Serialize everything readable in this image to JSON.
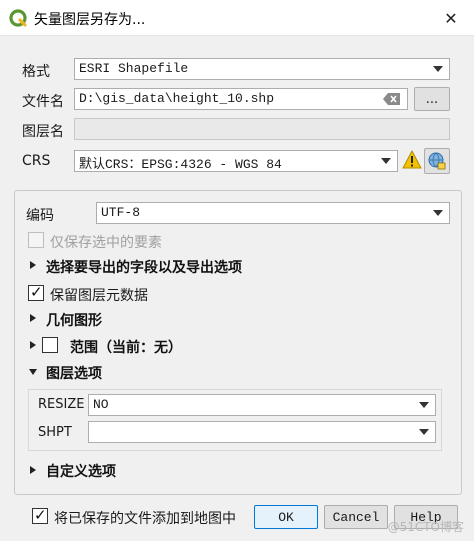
{
  "window": {
    "title": "矢量图层另存为...",
    "close_glyph": "✕"
  },
  "form": {
    "format_label": "格式",
    "format_value": "ESRI Shapefile",
    "filename_label": "文件名",
    "filename_value": "D:\\gis_data\\height_10.shp",
    "browse_label": "...",
    "layername_label": "图层名",
    "layername_value": "",
    "crs_label": "CRS",
    "crs_value": "默认CRS：EPSG:4326 - WGS 84"
  },
  "options": {
    "encoding_label": "编码",
    "encoding_value": "UTF-8",
    "selected_only_label": "仅保存选中的要素",
    "selected_only_checked": false,
    "fields_section": "选择要导出的字段以及导出选项",
    "keep_metadata_label": "保留图层元数据",
    "keep_metadata_checked": true,
    "geometry_section": "几何图形",
    "extent_section": "范围（当前：无）",
    "extent_checked": false,
    "layer_options_section": "图层选项",
    "resize_label": "RESIZE",
    "resize_value": "NO",
    "shpt_label": "SHPT",
    "shpt_value": "",
    "custom_options_section": "自定义选项"
  },
  "footer": {
    "add_to_map_label": "将已保存的文件添加到地图中",
    "add_to_map_checked": true,
    "ok_label": "OK",
    "cancel_label": "Cancel",
    "help_label": "Help",
    "watermark": "@51CTO博客"
  },
  "colors": {
    "accent": "#0078d7",
    "qgis_green": "#589632",
    "warning_yellow": "#f2c200"
  }
}
